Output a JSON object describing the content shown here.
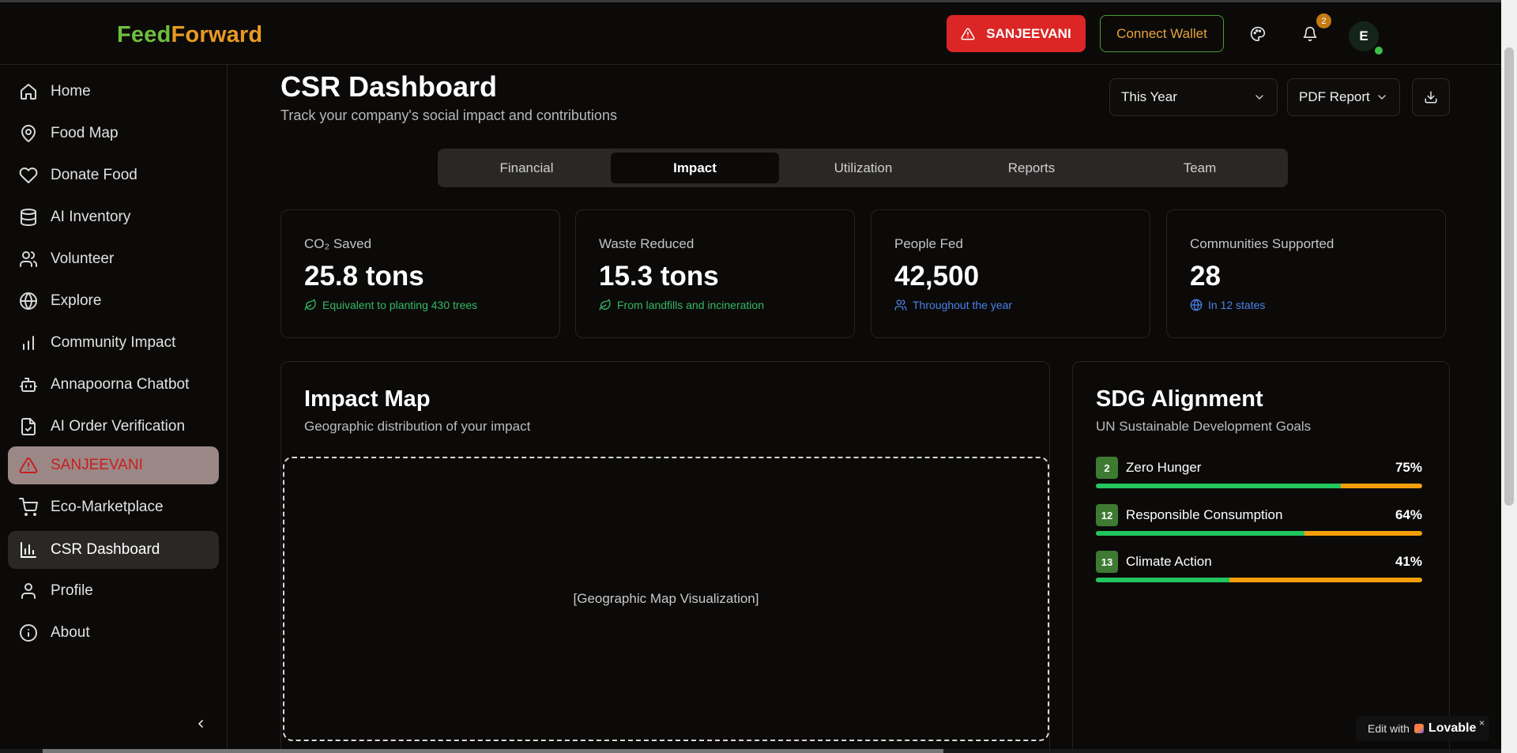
{
  "app": {
    "logo_part1": "Feed",
    "logo_part2": "Forward"
  },
  "header": {
    "sos_label": "SANJEEVANI",
    "wallet_label": "Connect Wallet",
    "notification_count": "2",
    "avatar_initial": "E"
  },
  "sidebar": {
    "items": [
      {
        "label": "Home",
        "icon": "home-icon"
      },
      {
        "label": "Food Map",
        "icon": "map-pin-icon"
      },
      {
        "label": "Donate Food",
        "icon": "heart-icon"
      },
      {
        "label": "AI Inventory",
        "icon": "database-icon"
      },
      {
        "label": "Volunteer",
        "icon": "users-icon"
      },
      {
        "label": "Explore",
        "icon": "globe-icon"
      },
      {
        "label": "Community Impact",
        "icon": "bar-chart-icon"
      },
      {
        "label": "Annapoorna Chatbot",
        "icon": "bot-icon"
      },
      {
        "label": "AI Order Verification",
        "icon": "clipboard-check-icon"
      },
      {
        "label": "SANJEEVANI",
        "icon": "alert-triangle-icon"
      },
      {
        "label": "Eco-Marketplace",
        "icon": "cart-icon"
      },
      {
        "label": "CSR Dashboard",
        "icon": "chart-icon"
      },
      {
        "label": "Profile",
        "icon": "user-icon"
      },
      {
        "label": "About",
        "icon": "info-icon"
      }
    ],
    "active": "CSR Dashboard"
  },
  "page": {
    "title": "CSR Dashboard",
    "subtitle": "Track your company's social impact and contributions",
    "period_select": "This Year",
    "report_select": "PDF Report"
  },
  "tabs": [
    {
      "label": "Financial"
    },
    {
      "label": "Impact"
    },
    {
      "label": "Utilization"
    },
    {
      "label": "Reports"
    },
    {
      "label": "Team"
    }
  ],
  "active_tab": "Impact",
  "stats": [
    {
      "label": "CO₂ Saved",
      "value": "25.8 tons",
      "note": "Equivalent to planting 430 trees",
      "note_color": "#34b864",
      "icon": "leaf-icon"
    },
    {
      "label": "Waste Reduced",
      "value": "15.3 tons",
      "note": "From landfills and incineration",
      "note_color": "#34b864",
      "icon": "leaf-icon"
    },
    {
      "label": "People Fed",
      "value": "42,500",
      "note": "Throughout the year",
      "note_color": "#4a82e8",
      "icon": "users-icon"
    },
    {
      "label": "Communities Supported",
      "value": "28",
      "note": "In 12 states",
      "note_color": "#4a82e8",
      "icon": "globe-icon"
    }
  ],
  "impact_map": {
    "title": "Impact Map",
    "subtitle": "Geographic distribution of your impact",
    "placeholder": "[Geographic Map Visualization]"
  },
  "sdg": {
    "title": "SDG Alignment",
    "subtitle": "UN Sustainable Development Goals",
    "goals": [
      {
        "number": "2",
        "name": "Zero Hunger",
        "percent": "75%",
        "value": 75
      },
      {
        "number": "12",
        "name": "Responsible Consumption",
        "percent": "64%",
        "value": 64
      },
      {
        "number": "13",
        "name": "Climate Action",
        "percent": "41%",
        "value": 41
      }
    ]
  },
  "badge": {
    "prefix": "Edit with",
    "brand": "Lovable",
    "close": "×"
  },
  "colors": {
    "accent_green": "#22c55e",
    "accent_orange": "#f59e0b",
    "sos_red": "#dc2626",
    "logo_green": "#6fbe3f",
    "logo_orange": "#e99a22"
  }
}
